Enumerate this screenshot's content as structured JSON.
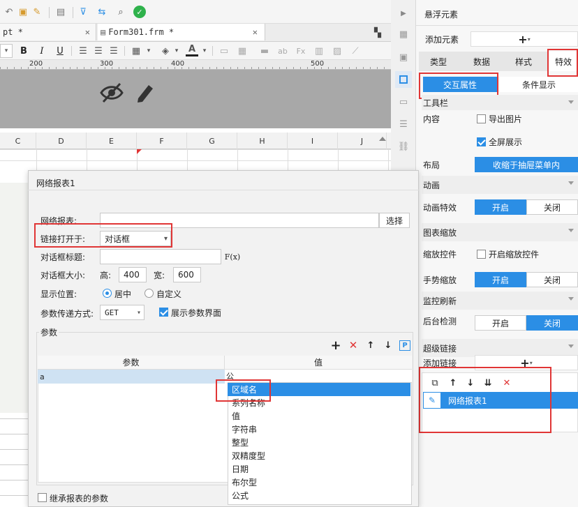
{
  "editor_tabs": [
    {
      "label": "pt *"
    },
    {
      "label": "Form301.frm *"
    }
  ],
  "ruler_marks": [
    "200",
    "300",
    "400",
    "500"
  ],
  "columns": [
    "C",
    "D",
    "E",
    "F",
    "G",
    "H",
    "I",
    "J"
  ],
  "float_panel": {
    "title": "悬浮元素",
    "add_element_label": "添加元素",
    "tabs": [
      "类型",
      "数据",
      "样式",
      "特效"
    ],
    "subtabs": [
      "交互属性",
      "条件显示"
    ],
    "toolbar_section": "工具栏",
    "content_label": "内容",
    "export_image_label": "导出图片",
    "export_image_checked": false,
    "fullscreen_label": "全屏展示",
    "fullscreen_checked": true,
    "layout_label": "布局",
    "layout_value": "收缩于抽屉菜单内",
    "animation_section": "动画",
    "animation_effect_label": "动画特效",
    "on_label": "开启",
    "off_label": "关闭",
    "animation_state": "开启",
    "zoom_section": "图表缩放",
    "zoom_control_label": "缩放控件",
    "zoom_control_option": "开启缩放控件",
    "zoom_control_checked": false,
    "gesture_zoom_label": "手势缩放",
    "gesture_zoom_state": "开启",
    "monitor_section": "监控刷新",
    "background_detect_label": "后台检测",
    "background_detect_state": "关闭",
    "hyperlink_section": "超级链接",
    "add_link_label": "添加链接",
    "links": [
      "网络报表1"
    ]
  },
  "dialog": {
    "title": "网络报表1",
    "report_label": "网络报表:",
    "report_value": "",
    "select_button": "选择",
    "open_in_label": "链接打开于:",
    "open_in_value": "对话框",
    "dialog_title_label": "对话框标题:",
    "dialog_title_value": "",
    "fx_button": "F(x)",
    "size_label": "对话框大小:",
    "height_label": "高:",
    "height_value": "400",
    "width_label": "宽:",
    "width_value": "600",
    "position_label": "显示位置:",
    "position_center": "居中",
    "position_custom": "自定义",
    "position_selected": "居中",
    "param_method_label": "参数传递方式:",
    "param_method_value": "GET",
    "show_params_label": "展示参数界面",
    "show_params_checked": true,
    "params_section": "参数",
    "param_col_name": "参数",
    "param_col_value": "值",
    "params": [
      {
        "name": "a",
        "value": "公"
      }
    ],
    "type_options": [
      "区域名",
      "系列名称",
      "值",
      "字符串",
      "整型",
      "双精度型",
      "日期",
      "布尔型",
      "公式"
    ],
    "selected_type": "区域名",
    "inherit_label": "继承报表的参数",
    "inherit_checked": false
  },
  "colors": {
    "accent": "#2b8ee5",
    "highlight": "#e03535",
    "selection": "#cfe2f3"
  }
}
